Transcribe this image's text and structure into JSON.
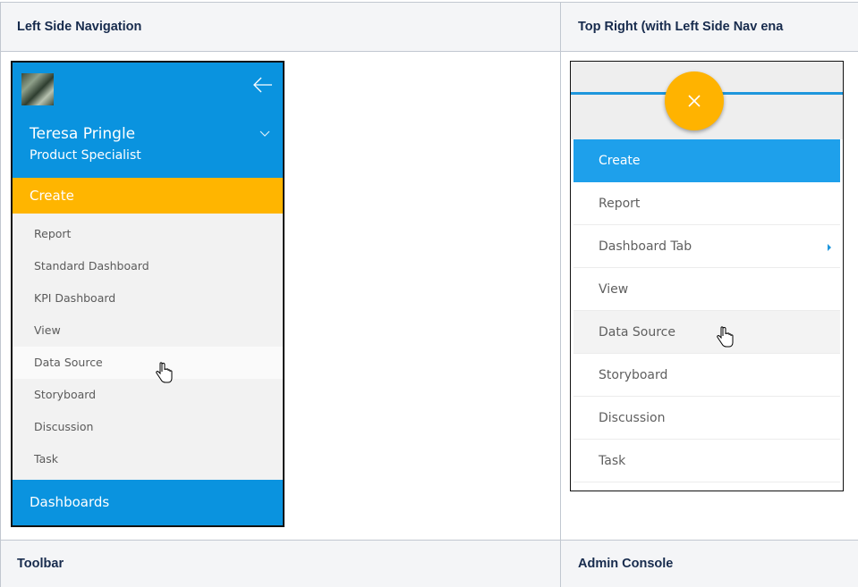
{
  "table": {
    "header_left": "Left Side Navigation",
    "header_right": "Top Right (with Left Side Nav ena",
    "footer_left": "Toolbar",
    "footer_right": "Admin Console"
  },
  "left_nav": {
    "user_name": "Teresa Pringle",
    "user_role": "Product Specialist",
    "create_label": "Create",
    "items": [
      "Report",
      "Standard Dashboard",
      "KPI Dashboard",
      "View",
      "Data Source",
      "Storyboard",
      "Discussion",
      "Task"
    ],
    "dashboards_label": "Dashboards"
  },
  "right_menu": {
    "create_label": "Create",
    "items": [
      "Report",
      "Dashboard Tab",
      "View",
      "Data Source",
      "Storyboard",
      "Discussion",
      "Task"
    ]
  },
  "colors": {
    "nav_blue": "#0a93df",
    "create_orange": "#ffb500",
    "menu_blue": "#1ea0eb",
    "fab_yellow": "#ffb300"
  },
  "icons": {
    "back": "arrow-left-icon",
    "expand": "chevron-down-icon",
    "close": "close-icon",
    "pointer": "hand-pointer-cursor-icon"
  }
}
